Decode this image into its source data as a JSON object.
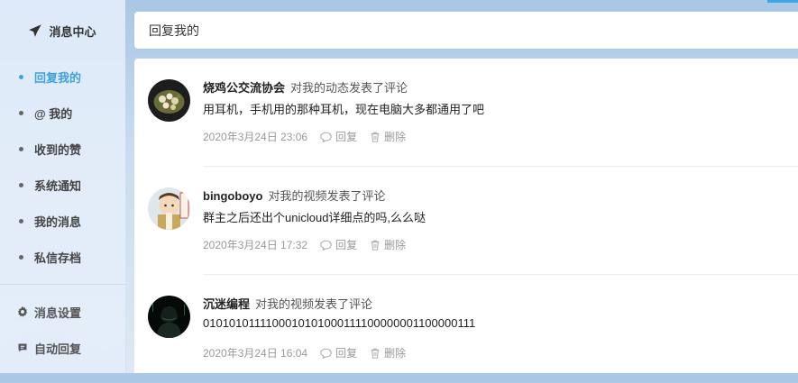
{
  "sidebar": {
    "title": "消息中心",
    "title_icon": "paper-plane-icon",
    "items": [
      {
        "label": "回复我的",
        "active": true
      },
      {
        "label": "@ 我的",
        "active": false
      },
      {
        "label": "收到的赞",
        "active": false
      },
      {
        "label": "系统通知",
        "active": false
      },
      {
        "label": "我的消息",
        "active": false
      },
      {
        "label": "私信存档",
        "active": false
      }
    ],
    "settings": [
      {
        "label": "消息设置",
        "icon": "gear-icon"
      },
      {
        "label": "自动回复",
        "icon": "chat-bubble-icon"
      }
    ]
  },
  "header": {
    "title": "回复我的"
  },
  "replies": [
    {
      "username": "烧鸡公交流协会",
      "action": "对我的动态发表了评论",
      "message": "用耳机，手机用的那种耳机，现在电脑大多都通用了吧",
      "time": "2020年3月24日 23:06",
      "reply_label": "回复",
      "delete_label": "删除"
    },
    {
      "username": "bingoboyo",
      "action": "对我的视频发表了评论",
      "message": "群主之后还出个unicloud详细点的吗,么么哒",
      "time": "2020年3月24日 17:32",
      "reply_label": "回复",
      "delete_label": "删除"
    },
    {
      "username": "沉迷编程",
      "action": "对我的视频发表了评论",
      "message": "0101010111100010101000111100000001100000111",
      "time": "2020年3月24日 16:04",
      "reply_label": "回复",
      "delete_label": "删除"
    }
  ],
  "colors": {
    "accent": "#3fa3d6",
    "meta": "#999999"
  }
}
